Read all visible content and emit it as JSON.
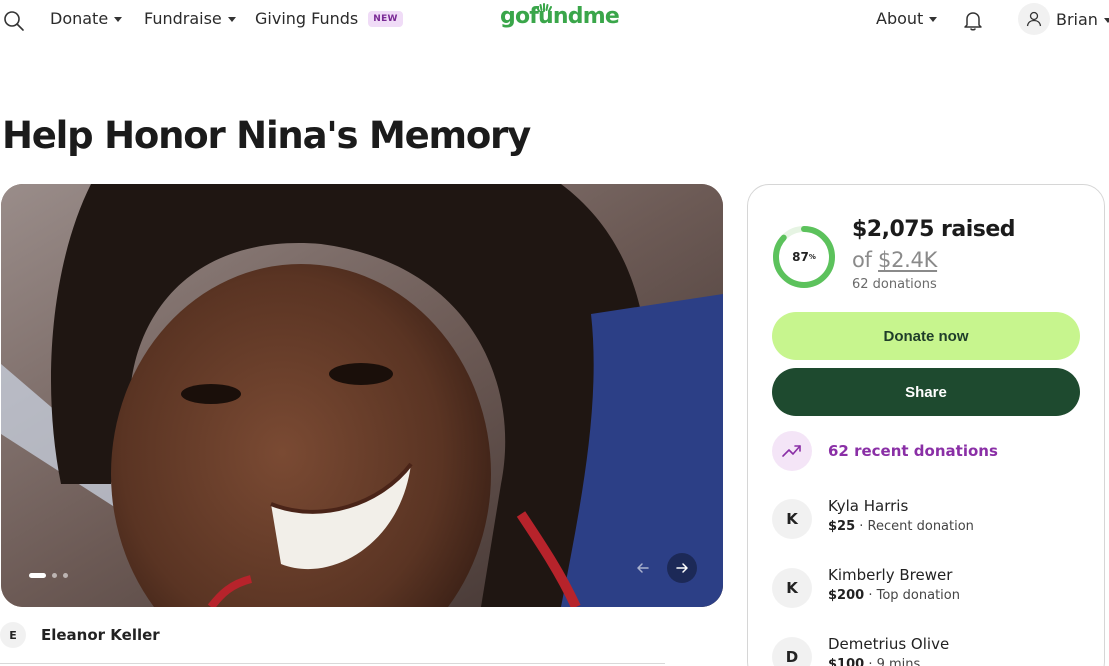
{
  "header": {
    "nav": [
      {
        "label": "Donate"
      },
      {
        "label": "Fundraise"
      },
      {
        "label": "Giving Funds",
        "badge": "NEW"
      }
    ],
    "logo": "gofundme",
    "about_label": "About",
    "user_name": "Brian"
  },
  "page": {
    "title": "Help Honor Nina's Memory",
    "organizer_initial": "E",
    "organizer_name": "Eleanor Keller"
  },
  "gallery": {
    "slide_count": 3,
    "active_slide": 1
  },
  "card": {
    "progress_percent": "87",
    "progress_fraction": 0.87,
    "raised": "$2,075 raised",
    "goal_prefix": "of",
    "goal_amount": "$2.4K",
    "donations": "62 donations",
    "donate_label": "Donate now",
    "share_label": "Share",
    "recent_label": "62 recent donations",
    "donors": [
      {
        "initial": "K",
        "name": "Kyla Harris",
        "amount": "$25",
        "note": "· Recent donation"
      },
      {
        "initial": "K",
        "name": "Kimberly Brewer",
        "amount": "$200",
        "note": "· Top donation"
      },
      {
        "initial": "D",
        "name": "Demetrius Olive",
        "amount": "$100",
        "note": "· 9 mins"
      }
    ]
  },
  "colors": {
    "brand_green": "#3aa64a",
    "donate_button": "#c7f58e",
    "share_button": "#1e4a2f",
    "recent_purple": "#8a2fa6",
    "ring_progress": "#5cc25c"
  }
}
